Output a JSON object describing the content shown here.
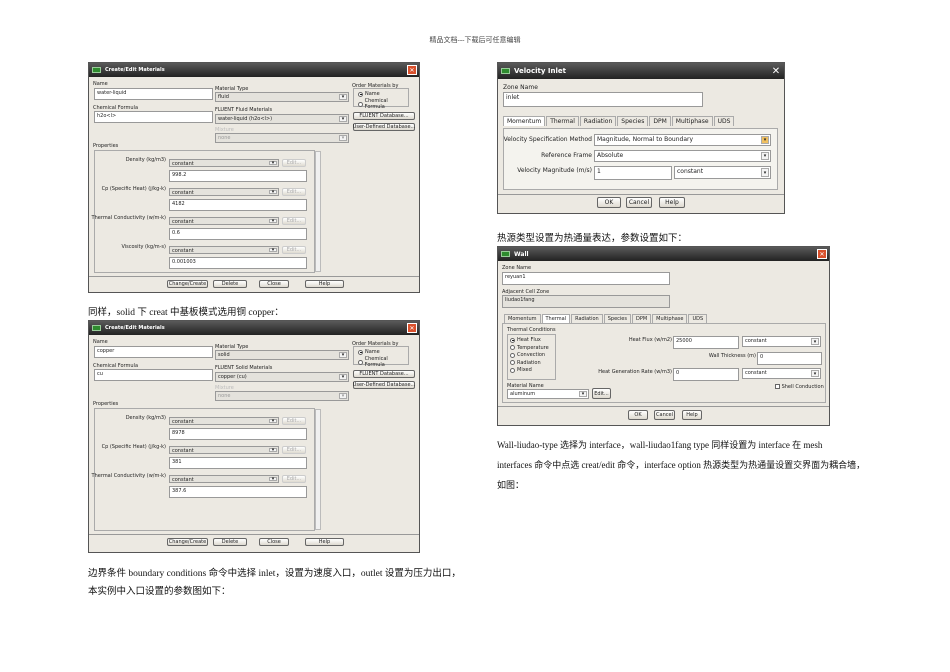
{
  "header": "精品文档---下载后可任意编辑",
  "paragraphs": {
    "p1": "同样，solid 下 creat 中基板模式选用铜 copper：",
    "p2_l1": "边界条件 boundary conditions 命令中选择 inlet，设置为速度入口，outlet 设置为压力出口，",
    "p2_l2": "本实例中入口设置的参数图如下：",
    "p3": "热源类型设置为热通量表达，参数设置如下：",
    "p4_l1": "Wall-liudao-type 选择为 interface，wall-liudao1fang type 同样设置为 interface 在 mesh",
    "p4_l2": "interfaces 命令中点选 creat/edit 命令，interface option 热源类型为热通量设置交界面为耦合墙，",
    "p4_l3": "如图："
  },
  "material_fluid": {
    "title": "Create/Edit Materials",
    "name_label": "Name",
    "name": "water-liquid",
    "formula_label": "Chemical Formula",
    "formula": "h2o<l>",
    "type_label": "Material Type",
    "type": "fluid",
    "db_label": "FLUENT Fluid Materials",
    "db_value": "water-liquid (h2o<l>)",
    "mixture_label": "Mixture",
    "mixture": "none",
    "order_label": "Order Materials by",
    "order_name": "Name",
    "order_formula": "Chemical Formula",
    "fluent_db": "FLUENT Database...",
    "user_db": "User-Defined Database...",
    "props_label": "Properties",
    "props": [
      {
        "label": "Density (kg/m3)",
        "method": "constant",
        "value": "998.2"
      },
      {
        "label": "Cp (Specific Heat) (j/kg-k)",
        "method": "constant",
        "value": "4182"
      },
      {
        "label": "Thermal Conductivity (w/m-k)",
        "method": "constant",
        "value": "0.6"
      },
      {
        "label": "Viscosity (kg/m-s)",
        "method": "constant",
        "value": "0.001003"
      }
    ],
    "edit": "Edit...",
    "change": "Change/Create",
    "delete": "Delete",
    "close": "Close",
    "help": "Help"
  },
  "material_solid": {
    "title": "Create/Edit Materials",
    "name_label": "Name",
    "name": "copper",
    "formula_label": "Chemical Formula",
    "formula": "cu",
    "type_label": "Material Type",
    "type": "solid",
    "db_label": "FLUENT Solid Materials",
    "db_value": "copper (cu)",
    "mixture_label": "Mixture",
    "mixture": "none",
    "order_label": "Order Materials by",
    "order_name": "Name",
    "order_formula": "Chemical Formula",
    "fluent_db": "FLUENT Database...",
    "user_db": "User-Defined Database...",
    "props_label": "Properties",
    "props": [
      {
        "label": "Density (kg/m3)",
        "method": "constant",
        "value": "8978"
      },
      {
        "label": "Cp (Specific Heat) (j/kg-k)",
        "method": "constant",
        "value": "381"
      },
      {
        "label": "Thermal Conductivity (w/m-k)",
        "method": "constant",
        "value": "387.6"
      }
    ],
    "edit": "Edit...",
    "change": "Change/Create",
    "delete": "Delete",
    "close": "Close",
    "help": "Help"
  },
  "velocity_inlet": {
    "title": "Velocity Inlet",
    "zone_label": "Zone Name",
    "zone": "inlet",
    "tabs": [
      "Momentum",
      "Thermal",
      "Radiation",
      "Species",
      "DPM",
      "Multiphase",
      "UDS"
    ],
    "spec_label": "Velocity Specification Method",
    "spec": "Magnitude, Normal to Boundary",
    "frame_label": "Reference Frame",
    "frame": "Absolute",
    "mag_label": "Velocity Magnitude (m/s)",
    "mag": "1",
    "mag_method": "constant",
    "ok": "OK",
    "cancel": "Cancel",
    "help": "Help"
  },
  "wall": {
    "title": "Wall",
    "zone_label": "Zone Name",
    "zone": "reyuan1",
    "adj_label": "Adjacent Cell Zone",
    "adj": "liudao1fang",
    "tabs": [
      "Momentum",
      "Thermal",
      "Radiation",
      "Species",
      "DPM",
      "Multiphase",
      "UDS"
    ],
    "cond_label": "Thermal Conditions",
    "conds": [
      "Heat Flux",
      "Temperature",
      "Convection",
      "Radiation",
      "Mixed"
    ],
    "flux_label": "Heat Flux (w/m2)",
    "flux": "25000",
    "flux_method": "constant",
    "thick_label": "Wall Thickness (m)",
    "thick": "0",
    "gen_label": "Heat Generation Rate (w/m3)",
    "gen": "0",
    "gen_method": "constant",
    "shell": "Shell Conduction",
    "mat_label": "Material Name",
    "mat": "aluminum",
    "edit": "Edit...",
    "ok": "OK",
    "cancel": "Cancel",
    "help": "Help"
  }
}
